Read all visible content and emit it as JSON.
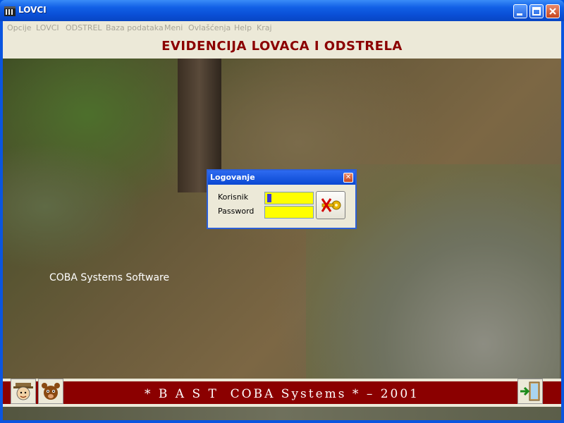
{
  "window": {
    "title": "LOVCI"
  },
  "menu": [
    "Opcije",
    "LOVCI",
    "ODSTREL",
    "Baza podataka",
    "Meni",
    "Ovlašćenja",
    "Help",
    "Kraj"
  ],
  "banner": {
    "title": "EVIDENCIJA LOVACA I ODSTRELA"
  },
  "watermark": "COBA Systems Software",
  "login_dialog": {
    "title": "Logovanje",
    "username_label": "Korisnik",
    "password_label": "Password",
    "username_value": "",
    "password_value": "",
    "input_color": "#ffff00",
    "login_icon": "key-icon"
  },
  "footer": {
    "text": "* B A S T  COBA Systems * – 2001",
    "bar_color": "#8b0000"
  },
  "icons": {
    "left_1": "hunter-icon",
    "left_2": "animal-icon",
    "right": "exit-door-icon"
  },
  "colors": {
    "title_red": "#8b0000",
    "menu_gray": "#a8a597",
    "xp_blue": "#0054e3"
  }
}
